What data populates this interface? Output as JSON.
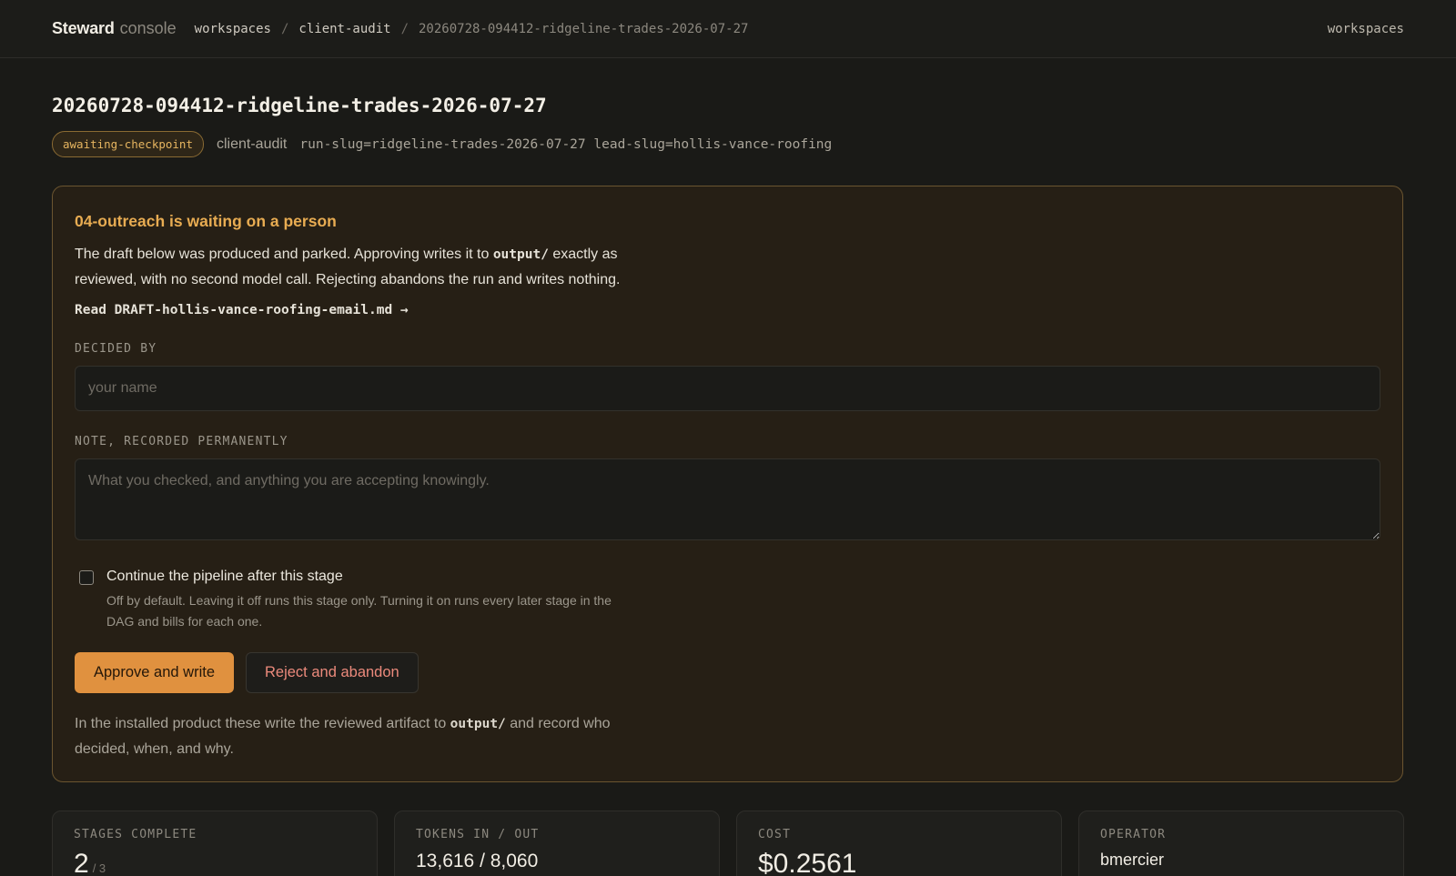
{
  "header": {
    "brand": "Steward",
    "brand_sub": "console",
    "breadcrumb": [
      "workspaces",
      "client-audit",
      "20260728-094412-ridgeline-trades-2026-07-27"
    ],
    "separator": "/",
    "nav_right": "workspaces"
  },
  "run": {
    "title": "20260728-094412-ridgeline-trades-2026-07-27",
    "status": "awaiting-checkpoint",
    "workspace": "client-audit",
    "slugs": "run-slug=ridgeline-trades-2026-07-27 lead-slug=hollis-vance-roofing"
  },
  "checkpoint": {
    "heading": "04-outreach is waiting on a person",
    "desc_before": "The draft below was produced and parked. Approving writes it to ",
    "desc_code": "output/",
    "desc_after": " exactly as reviewed, with no second model call. Rejecting abandons the run and writes nothing.",
    "draft_link": "Read DRAFT-hollis-vance-roofing-email.md →",
    "decided_by_label": "DECIDED BY",
    "decided_by_placeholder": "your name",
    "note_label": "NOTE, RECORDED PERMANENTLY",
    "note_placeholder": "What you checked, and anything you are accepting knowingly.",
    "continue_label": "Continue the pipeline after this stage",
    "continue_help": "Off by default. Leaving it off runs this stage only. Turning it on runs every later stage in the DAG and bills for each one.",
    "approve_label": "Approve and write",
    "reject_label": "Reject and abandon",
    "foot_before": "In the installed product these write the reviewed artifact to ",
    "foot_code": "output/",
    "foot_after": " and record who decided, when, and why."
  },
  "stats": {
    "stages_label": "STAGES COMPLETE",
    "stages_value": "2",
    "stages_total": "/ 3",
    "tokens_label": "TOKENS IN / OUT",
    "tokens_value": "13,616 / 8,060",
    "cost_label": "COST",
    "cost_value": "$0.2561",
    "operator_label": "OPERATOR",
    "operator_value": "bmercier"
  },
  "colors": {
    "accent": "#e0913f",
    "warning_heading": "#e8ac52",
    "reject_text": "#ec8a7c",
    "panel_bg": "#261f15"
  }
}
